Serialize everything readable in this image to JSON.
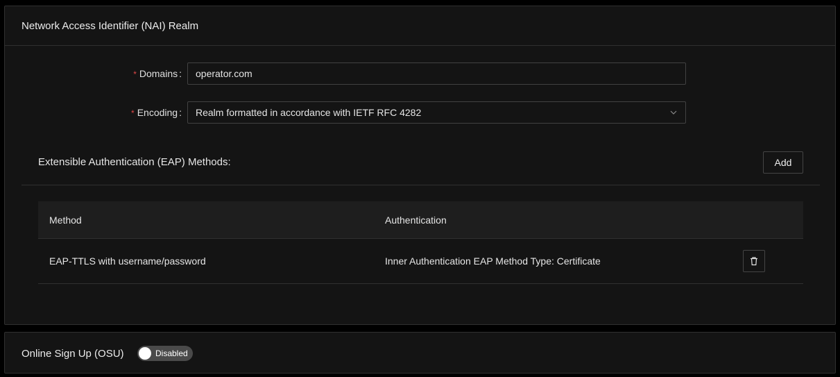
{
  "nai": {
    "title": "Network Access Identifier (NAI) Realm",
    "domains": {
      "required_mark": "*",
      "label": "Domains",
      "value": "operator.com"
    },
    "encoding": {
      "required_mark": "*",
      "label": "Encoding",
      "value": "Realm formatted in accordance with IETF RFC 4282"
    },
    "eap": {
      "title": "Extensible Authentication (EAP) Methods:",
      "add_label": "Add",
      "columns": {
        "method": "Method",
        "authentication": "Authentication"
      },
      "rows": [
        {
          "method": "EAP-TTLS with username/password",
          "authentication": "Inner Authentication EAP Method Type: Certificate",
          "action_icon": "trash-icon"
        }
      ]
    }
  },
  "osu": {
    "title": "Online Sign Up (OSU)",
    "toggle_label": "Disabled",
    "toggle_on": false
  },
  "colors": {
    "background": "#141414",
    "border": "#303030",
    "required": "#e04848",
    "toggle_off": "#4a4a4a"
  }
}
